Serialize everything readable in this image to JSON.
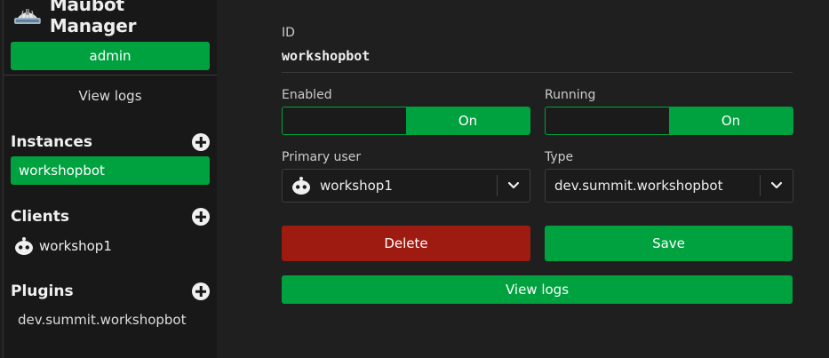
{
  "app": {
    "title": "Maubot Manager",
    "logo_icon": "maubot-logo-icon"
  },
  "sidebar": {
    "user_button": "admin",
    "view_logs": "View logs",
    "sections": {
      "instances": {
        "title": "Instances",
        "add_icon": "plus-circle-icon",
        "items": [
          {
            "label": "workshopbot",
            "active": true
          }
        ]
      },
      "clients": {
        "title": "Clients",
        "add_icon": "plus-circle-icon",
        "items": [
          {
            "label": "workshop1",
            "icon": "robot-avatar-icon"
          }
        ]
      },
      "plugins": {
        "title": "Plugins",
        "add_icon": "plus-circle-icon",
        "items": [
          {
            "label": "dev.summit.workshopbot"
          }
        ]
      }
    }
  },
  "main": {
    "id": {
      "label": "ID",
      "value": "workshopbot"
    },
    "enabled": {
      "label": "Enabled",
      "state_label": "On",
      "on": true
    },
    "running": {
      "label": "Running",
      "state_label": "On",
      "on": true
    },
    "primary_user": {
      "label": "Primary user",
      "value": "workshop1",
      "icon": "robot-avatar-icon",
      "dropdown_icon": "chevron-down-icon"
    },
    "type": {
      "label": "Type",
      "value": "dev.summit.workshopbot",
      "dropdown_icon": "chevron-down-icon"
    },
    "buttons": {
      "delete": "Delete",
      "save": "Save",
      "view_logs": "View logs"
    }
  },
  "colors": {
    "accent": "#00a23f",
    "danger": "#9e1b11",
    "background": "#1f1f1f",
    "sidebar": "#181818"
  }
}
